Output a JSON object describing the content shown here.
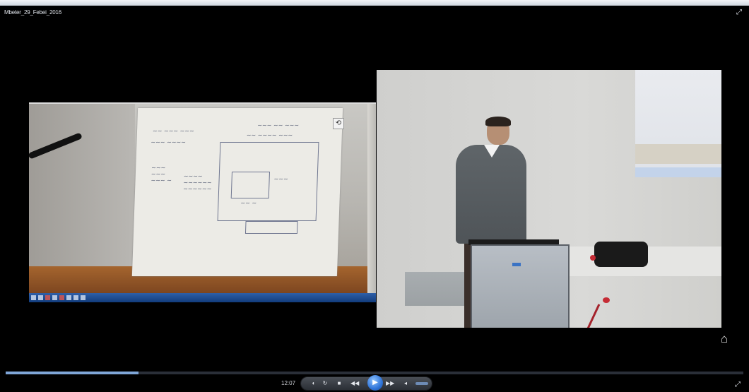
{
  "window": {
    "title": "Mbeter_29_Febei_2016"
  },
  "player": {
    "current_time": "12:07",
    "progress_percent": 18
  },
  "icons": {
    "fullscreen_top": "fullscreen-icon",
    "rotate": "rotate-icon",
    "home": "home-icon",
    "fullscreen_bottom": "fullscreen-icon"
  },
  "colors": {
    "background": "#000000",
    "progress_fill": "#7fa6d8",
    "play_button": "#2f74d8"
  }
}
